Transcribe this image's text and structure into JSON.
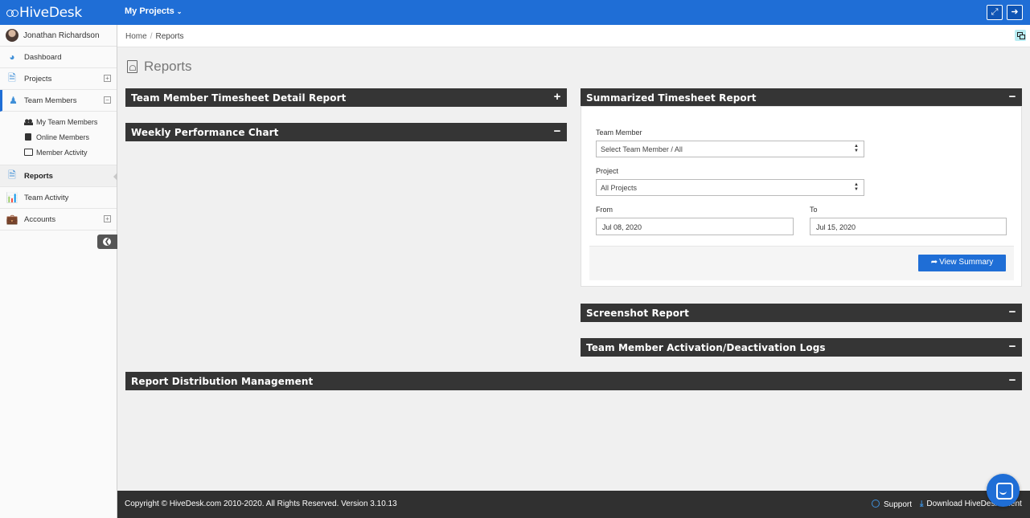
{
  "app": {
    "logo_text": "HiveDesk"
  },
  "topbar": {
    "projects_menu": "My Projects"
  },
  "sidebar": {
    "user_name": "Jonathan Richardson",
    "items": [
      {
        "label": "Dashboard"
      },
      {
        "label": "Projects"
      },
      {
        "label": "Team Members"
      },
      {
        "label": "Reports"
      },
      {
        "label": "Team Activity"
      },
      {
        "label": "Accounts"
      }
    ],
    "team_sub": [
      {
        "label": "My Team Members"
      },
      {
        "label": "Online Members"
      },
      {
        "label": "Member Activity"
      }
    ]
  },
  "breadcrumb": {
    "home": "Home",
    "current": "Reports"
  },
  "page": {
    "title": "Reports"
  },
  "panels": {
    "timesheet_detail": "Team Member Timesheet Detail Report",
    "weekly_performance": "Weekly Performance Chart",
    "summarized": "Summarized Timesheet Report",
    "screenshot": "Screenshot Report",
    "activation_logs": "Team Member Activation/Deactivation Logs",
    "distribution": "Report Distribution Management"
  },
  "summary_form": {
    "team_member_label": "Team Member",
    "team_member_value": "Select Team Member / All",
    "project_label": "Project",
    "project_value": "All Projects",
    "from_label": "From",
    "from_value": "Jul 08, 2020",
    "to_label": "To",
    "to_value": "Jul 15, 2020",
    "submit_label": "View Summary"
  },
  "footer": {
    "copyright": "Copyright © HiveDesk.com 2010-2020. All Rights Reserved. Version 3.10.13",
    "support": "Support",
    "download": "Download HiveDesk Client"
  },
  "colors": {
    "brand_blue": "#1f6ed6",
    "panel_header": "#353535",
    "footer": "#303030"
  }
}
